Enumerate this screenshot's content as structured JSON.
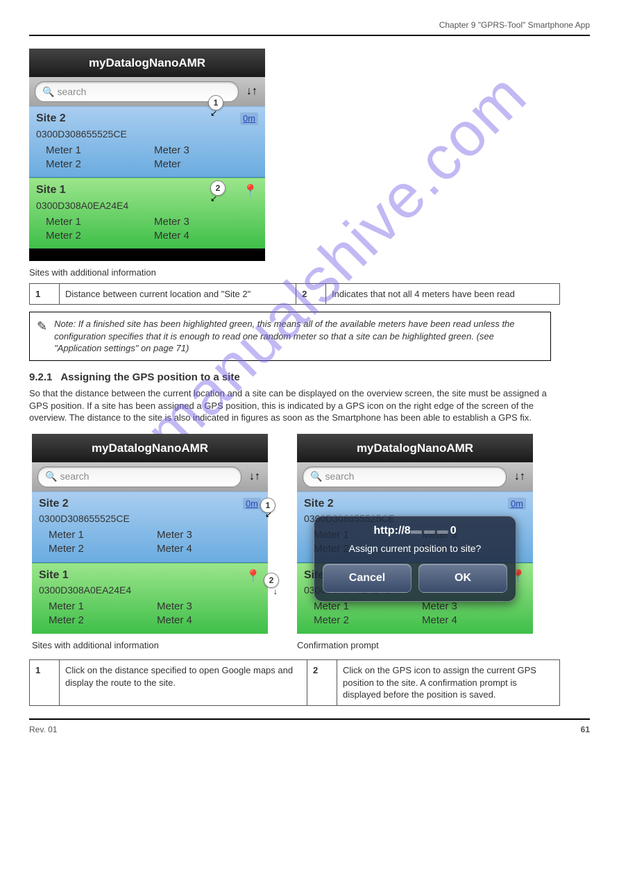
{
  "header": {
    "left": "",
    "right": "Chapter 9 \"GPRS-Tool\" Smartphone App"
  },
  "footer": {
    "rev": "Rev. 01",
    "page": "61"
  },
  "watermark": "manualshive.com",
  "phone_title": "myDatalogNanoAMR",
  "search_placeholder": "search",
  "sort_glyph": "↓↑",
  "mag_glyph": "🔍",
  "pin_glyph": "📍",
  "dist_label": "0m",
  "site2": {
    "name": "Site 2",
    "serial": "0300D308655525CE",
    "meters_a": [
      "Meter 1",
      "Meter 3",
      "Meter 2",
      "Meter 4"
    ],
    "meters_b": [
      "Meter 1",
      "Meter 3",
      "Meter 2",
      "Meter"
    ]
  },
  "site1": {
    "name": "Site 1",
    "serial": "0300D308A0EA24E4",
    "meters": [
      "Meter 1",
      "Meter 3",
      "Meter 2",
      "Meter 4"
    ]
  },
  "fig1": {
    "caption": "Sites with additional information",
    "legend": [
      [
        "1",
        "Distance between current location and \"Site 2\""
      ],
      [
        "2",
        "Indicates that not all 4 meters have been read"
      ]
    ],
    "callouts": {
      "c1": "1",
      "c2": "2"
    }
  },
  "note": {
    "text": "Note: If a finished site has been highlighted green, this means all of the available meters have been read unless the configuration specifies that it is enough to read one random meter so that a site can be highlighted green. (see \"Application settings\" on page 71)"
  },
  "section": {
    "num": "9.2.1",
    "title": "Assigning the GPS position to a site",
    "body": "So that the distance between the current location and a site can be displayed on the overview screen, the site must be assigned a GPS position. If a site has been assigned a GPS position, this is indicated by a GPS icon on the right edge of the screen of the overview. The distance to the site is also indicated in figures as soon as the Smartphone has been able to establish a GPS fix."
  },
  "fig2": {
    "caption_left": "Sites with additional information",
    "caption_right": "Confirmation prompt",
    "legend": [
      [
        "1",
        "Click on the distance specified to open Google maps and display the route to the site."
      ],
      [
        "2",
        "Click on the GPS icon to assign the current GPS position to the site. A confirmation prompt is displayed before the position is saved."
      ]
    ],
    "callouts": {
      "c1": "1",
      "c2": "2"
    }
  },
  "modal": {
    "title_prefix": "http://8",
    "title_suffix": "0",
    "message": "Assign current position to site?",
    "cancel": "Cancel",
    "ok": "OK"
  }
}
